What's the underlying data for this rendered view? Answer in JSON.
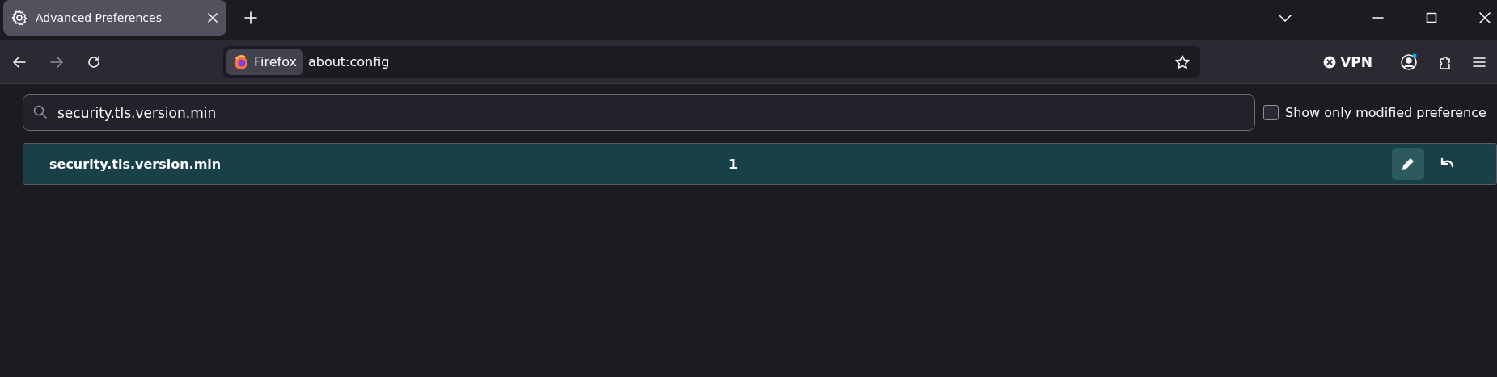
{
  "tabs": [
    {
      "title": "Advanced Preferences",
      "selected": true
    }
  ],
  "toolbar": {
    "identity_label": "Firefox",
    "url": "about:config",
    "vpn_label": "VPN",
    "account_notification": true
  },
  "search": {
    "value": "security.tls.version.min"
  },
  "show_only_modified": {
    "label": "Show only modified preference",
    "checked": false
  },
  "preferences": [
    {
      "name": "security.tls.version.min",
      "value": "1",
      "modified": true
    }
  ]
}
